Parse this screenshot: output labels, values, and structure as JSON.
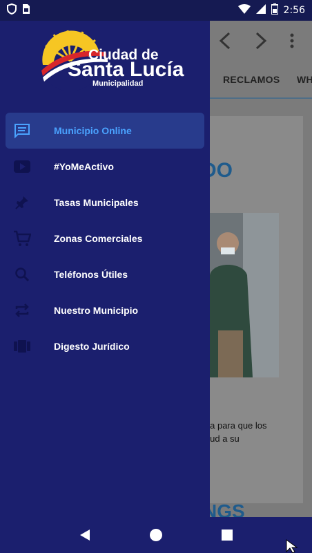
{
  "status_bar": {
    "time": "2:56",
    "icons": [
      "shield-icon",
      "sim-icon",
      "wifi-icon",
      "signal-icon",
      "battery-icon"
    ]
  },
  "logo": {
    "line1": "Ciudad de",
    "line2": "Santa Lucía",
    "line3": "Municipalidad"
  },
  "background": {
    "tabs": [
      "RECLAMOS",
      "WH"
    ],
    "heading": "DO",
    "text_lines": [
      "aja para que los",
      "alud a su"
    ],
    "heading2": "NGS"
  },
  "menu": {
    "items": [
      {
        "label": "Municipio Online",
        "icon": "chat-icon",
        "active": true
      },
      {
        "label": "#YoMeActivo",
        "icon": "youtube-icon",
        "active": false
      },
      {
        "label": "Tasas Municipales",
        "icon": "pin-icon",
        "active": false
      },
      {
        "label": "Zonas Comerciales",
        "icon": "cart-icon",
        "active": false
      },
      {
        "label": "Teléfonos Útiles",
        "icon": "search-icon",
        "active": false
      },
      {
        "label": "Nuestro Municipio",
        "icon": "repeat-icon",
        "active": false
      },
      {
        "label": "Digesto Jurídico",
        "icon": "book-icon",
        "active": false
      }
    ]
  },
  "colors": {
    "drawer_bg": "#1b1f6e",
    "active_bg": "#283b8c",
    "active_text": "#4aa3ff"
  }
}
